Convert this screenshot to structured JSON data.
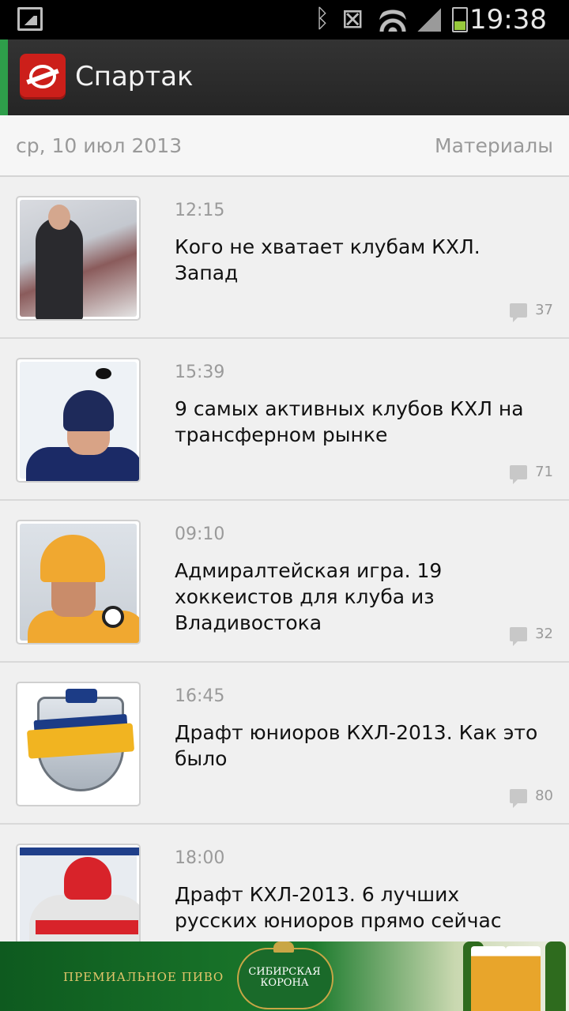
{
  "status_bar": {
    "time": "19:38"
  },
  "action_bar": {
    "title": "Спартак"
  },
  "date_header": {
    "date": "ср, 10 июл 2013",
    "section": "Материалы"
  },
  "feed": [
    {
      "time": "12:15",
      "title": "Кого не хватает клубам КХЛ. Запад",
      "comments": "37"
    },
    {
      "time": "15:39",
      "title": "9 самых активных клубов КХЛ на трансферном рынке",
      "comments": "71"
    },
    {
      "time": "09:10",
      "title": "Адмиралтейская игра. 19 хоккеистов для клуба из Владивостока",
      "comments": "32"
    },
    {
      "time": "16:45",
      "title": "Драфт юниоров КХЛ-2013. Как это было",
      "comments": "80"
    },
    {
      "time": "18:00",
      "title": "Драфт КХЛ-2013. 6 лучших русских юниоров прямо сейчас"
    }
  ],
  "ad": {
    "tagline": "ПРЕМИАЛЬНОЕ ПИВО",
    "brand": "СИБИРСКАЯ КОРОНА"
  },
  "colors": {
    "accent": "#2e9e4a",
    "logo_red": "#cc1f1a",
    "action_bar": "#2b2b2b",
    "background": "#f0f0f0"
  }
}
